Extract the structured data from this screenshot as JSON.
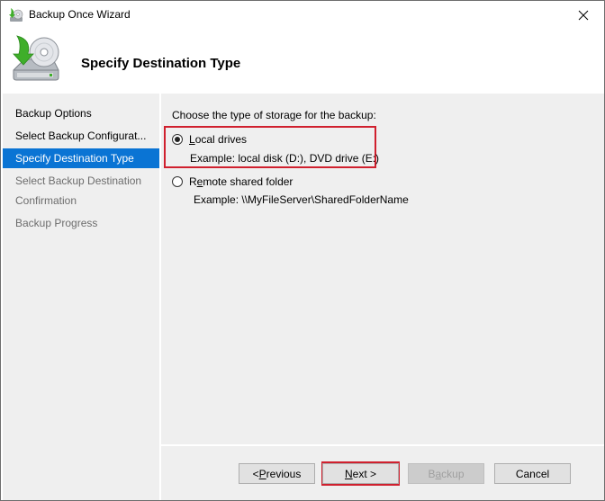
{
  "window": {
    "title": "Backup Once Wizard",
    "close_icon": "close-icon"
  },
  "header": {
    "icon": "backup-drive-icon",
    "title": "Specify Destination Type"
  },
  "sidebar": {
    "items": [
      {
        "label": "Backup Options",
        "state": "done"
      },
      {
        "label": "Select Backup Configurat...",
        "state": "done"
      },
      {
        "label": "Specify Destination Type",
        "state": "active"
      },
      {
        "label": "Select Backup Destination",
        "state": "pending"
      },
      {
        "label": "Confirmation",
        "state": "pending"
      },
      {
        "label": "Backup Progress",
        "state": "pending"
      }
    ]
  },
  "main": {
    "prompt": "Choose the type of storage for the backup:",
    "options": [
      {
        "label_accel": "L",
        "label_rest": "ocal drives",
        "example": "Example: local disk (D:), DVD drive (E:)",
        "checked": true
      },
      {
        "label_pre": "R",
        "label_accel": "e",
        "label_rest": "mote shared folder",
        "example": "Example: \\\\MyFileServer\\SharedFolderName",
        "checked": false
      }
    ]
  },
  "buttons": {
    "previous": {
      "pre": "< ",
      "accel": "P",
      "rest": "revious"
    },
    "next": {
      "accel": "N",
      "rest": "ext >"
    },
    "backup": {
      "pre": "B",
      "accel": "a",
      "rest": "ckup",
      "enabled": false
    },
    "cancel": {
      "label": "Cancel"
    }
  },
  "colors": {
    "accent": "#0a74d4",
    "highlight_box": "#d0202e"
  }
}
